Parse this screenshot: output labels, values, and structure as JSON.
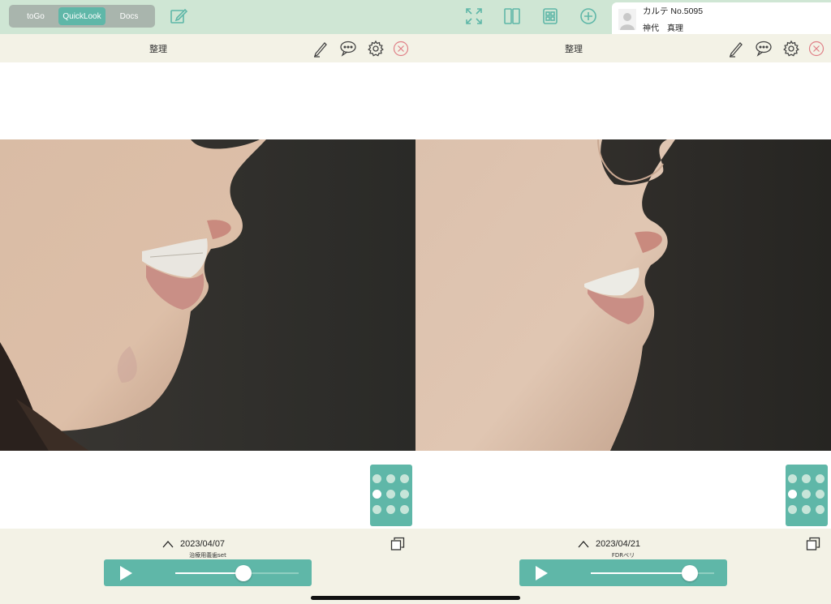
{
  "topbar": {
    "segments": [
      {
        "label": "toGo",
        "active": false
      },
      {
        "label": "QuickLook",
        "active": true
      },
      {
        "label": "Docs",
        "active": false
      }
    ],
    "icons": [
      "edit-icon",
      "expand-icon",
      "split-view-icon",
      "photo-grid-icon",
      "add-icon"
    ],
    "patient": {
      "number": "カルテ No.5095",
      "name": "神代　真理"
    }
  },
  "panels": [
    {
      "title": "整理",
      "date": "2023/04/07",
      "subtitle": "治療用義歯set",
      "slider_value": 0.55,
      "selected_dot": 3
    },
    {
      "title": "整理",
      "date": "2023/04/21",
      "subtitle": "FDRベリ",
      "slider_value": 0.8,
      "selected_dot": 3
    }
  ],
  "colors": {
    "topbar": "#cfe6d4",
    "accent": "#5fb7a8",
    "panel_bar": "#f3f2e6",
    "close": "#e07f86"
  }
}
